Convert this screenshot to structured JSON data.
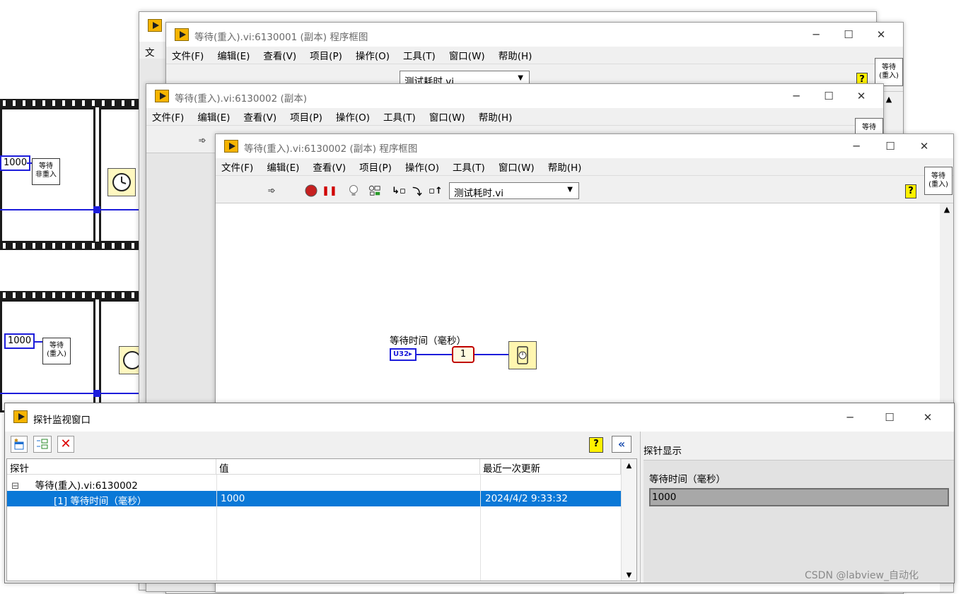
{
  "windows": {
    "back": {
      "title": "等待(重入).vi:6130001 (副本) 程序框图",
      "menu_first": "文件"
    },
    "middle": {
      "title": "等待(重入).vi:6130002 (副本)"
    },
    "front": {
      "title": "等待(重入).vi:6130002 (副本) 程序框图"
    }
  },
  "menu": [
    "文件(F)",
    "编辑(E)",
    "查看(V)",
    "项目(P)",
    "操作(O)",
    "工具(T)",
    "窗口(W)",
    "帮助(H)"
  ],
  "toolbar": {
    "vi_selector": "测试耗时.vi"
  },
  "connector_pane": {
    "line1": "等待",
    "line2": "(重入)"
  },
  "left_diagram": {
    "const_top": "1000",
    "const_bottom": "1000",
    "subvi_top_line1": "等待",
    "subvi_top_line2": "非重入",
    "subvi_bottom_line1": "等待",
    "subvi_bottom_line2": "(重入)"
  },
  "diagram": {
    "control_label": "等待时间（毫秒）",
    "control_type": "U32",
    "probe_number": "1"
  },
  "probe_window": {
    "title": "探针监视窗口",
    "columns": [
      "探针",
      "值",
      "最近一次更新"
    ],
    "group_row": {
      "toggle": "⊟",
      "label": "等待(重入).vi:6130002"
    },
    "selected_row": {
      "probe": "[1] 等待时间（毫秒）",
      "value": "1000",
      "updated": "2024/4/2 9:33:32"
    },
    "display_panel": {
      "title": "探针显示",
      "label": "等待时间（毫秒）",
      "value": "1000"
    }
  },
  "watermark": "CSDN @labview_自动化",
  "colors": {
    "accent_blue": "#0a78d7",
    "wire_blue": "#1d1ddb",
    "probe_red": "#c00000",
    "lv_yellow": "#f5b400"
  }
}
